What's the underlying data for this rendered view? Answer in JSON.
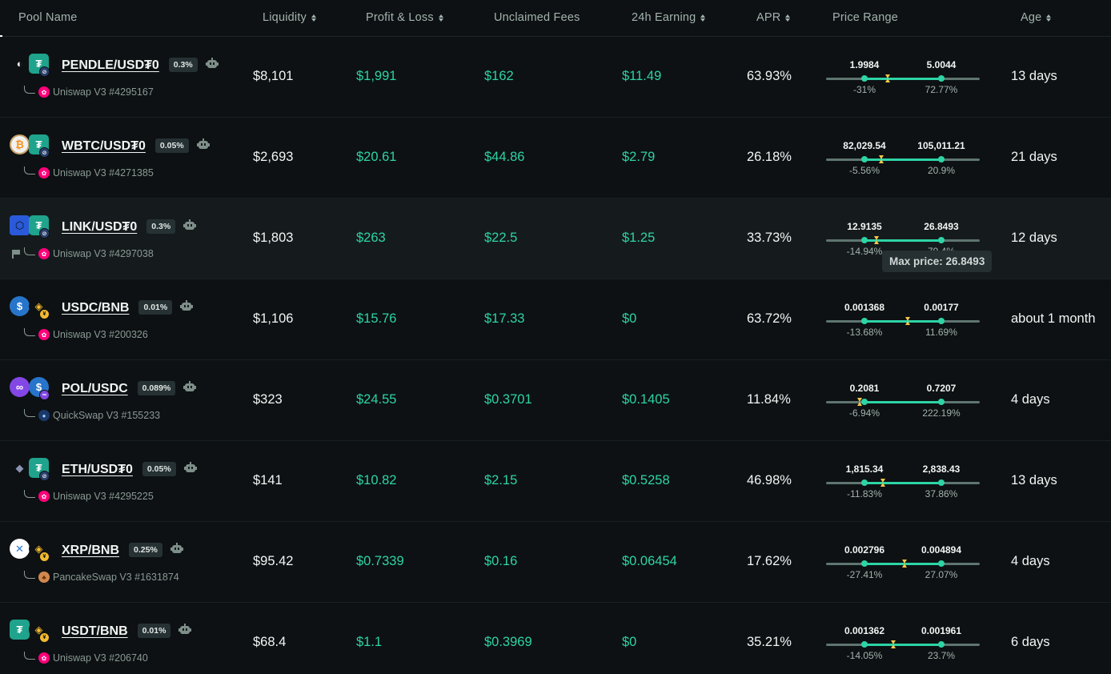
{
  "header": {
    "pool_name": "Pool Name",
    "liquidity": "Liquidity",
    "pnl": "Profit & Loss",
    "unclaimed": "Unclaimed Fees",
    "earning": "24h Earning",
    "apr": "APR",
    "range": "Price Range",
    "age": "Age"
  },
  "tooltip": "Max price: 26.8493",
  "rows": [
    {
      "pair": "PENDLE/USD₮0",
      "fee": "0.3%",
      "dex": "Uniswap V3 #4295167",
      "liquidity": "$8,101",
      "pnl": "$1,991",
      "unclaimed": "$162",
      "earning": "$11.49",
      "apr": "63.93%",
      "min": "1.9984",
      "max": "5.0044",
      "min_pct": "-31%",
      "max_pct": "72.77%",
      "age": "13 days",
      "coin_a": "pendle-icon",
      "coin_b": "usdt0-icon",
      "dex_icon": "uniswap-icon",
      "current": 0.4
    },
    {
      "pair": "WBTC/USD₮0",
      "fee": "0.05%",
      "dex": "Uniswap V3 #4271385",
      "liquidity": "$2,693",
      "pnl": "$20.61",
      "unclaimed": "$44.86",
      "earning": "$2.79",
      "apr": "26.18%",
      "min": "82,029.54",
      "max": "105,011.21",
      "min_pct": "-5.56%",
      "max_pct": "20.9%",
      "age": "21 days",
      "coin_a": "bitcoin-icon",
      "coin_b": "usdt0-icon",
      "dex_icon": "uniswap-icon",
      "current": 0.36
    },
    {
      "pair": "LINK/USD₮0",
      "fee": "0.3%",
      "dex": "Uniswap V3 #4297038",
      "liquidity": "$1,803",
      "pnl": "$263",
      "unclaimed": "$22.5",
      "earning": "$1.25",
      "apr": "33.73%",
      "min": "12.9135",
      "max": "26.8493",
      "min_pct": "-14.94%",
      "max_pct": "79.4%",
      "age": "12 days",
      "coin_a": "chainlink-icon",
      "coin_b": "usdt0-icon",
      "dex_icon": "uniswap-icon",
      "current": 0.33
    },
    {
      "pair": "USDC/BNB",
      "fee": "0.01%",
      "dex": "Uniswap V3 #200326",
      "liquidity": "$1,106",
      "pnl": "$15.76",
      "unclaimed": "$17.33",
      "earning": "$0",
      "apr": "63.72%",
      "min": "0.001368",
      "max": "0.00177",
      "min_pct": "-13.68%",
      "max_pct": "11.69%",
      "age": "about 1 month",
      "coin_a": "usdc-icon",
      "coin_b": "bnb-icon",
      "dex_icon": "uniswap-icon",
      "current": 0.53
    },
    {
      "pair": "POL/USDC",
      "fee": "0.089%",
      "dex": "QuickSwap V3 #155233",
      "liquidity": "$323",
      "pnl": "$24.55",
      "unclaimed": "$0.3701",
      "earning": "$0.1405",
      "apr": "11.84%",
      "min": "0.2081",
      "max": "0.7207",
      "min_pct": "-6.94%",
      "max_pct": "222.19%",
      "age": "4 days",
      "coin_a": "polygon-icon",
      "coin_b": "usdc-icon",
      "dex_icon": "quickswap-icon",
      "current": 0.22
    },
    {
      "pair": "ETH/USD₮0",
      "fee": "0.05%",
      "dex": "Uniswap V3 #4295225",
      "liquidity": "$141",
      "pnl": "$10.82",
      "unclaimed": "$2.15",
      "earning": "$0.5258",
      "apr": "46.98%",
      "min": "1,815.34",
      "max": "2,838.43",
      "min_pct": "-11.83%",
      "max_pct": "37.86%",
      "age": "13 days",
      "coin_a": "ethereum-icon",
      "coin_b": "usdt0-icon",
      "dex_icon": "uniswap-icon",
      "current": 0.37
    },
    {
      "pair": "XRP/BNB",
      "fee": "0.25%",
      "dex": "PancakeSwap V3 #1631874",
      "liquidity": "$95.42",
      "pnl": "$0.7339",
      "unclaimed": "$0.16",
      "earning": "$0.06454",
      "apr": "17.62%",
      "min": "0.002796",
      "max": "0.004894",
      "min_pct": "-27.41%",
      "max_pct": "27.07%",
      "age": "4 days",
      "coin_a": "xrp-icon",
      "coin_b": "bnb-icon",
      "dex_icon": "pancakeswap-icon",
      "current": 0.51
    },
    {
      "pair": "USDT/BNB",
      "fee": "0.01%",
      "dex": "Uniswap V3 #206740",
      "liquidity": "$68.4",
      "pnl": "$1.1",
      "unclaimed": "$0.3969",
      "earning": "$0",
      "apr": "35.21%",
      "min": "0.001362",
      "max": "0.001961",
      "min_pct": "-14.05%",
      "max_pct": "23.7%",
      "age": "6 days",
      "coin_a": "tether-icon",
      "coin_b": "bnb-icon",
      "dex_icon": "uniswap-icon",
      "current": 0.44
    }
  ]
}
